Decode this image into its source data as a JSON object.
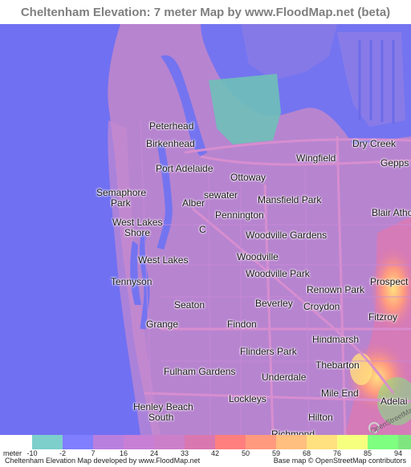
{
  "title": "Cheltenham Elevation: 7 meter Map by www.FloodMap.net (beta)",
  "places": [
    {
      "name": "Peterhead",
      "id": "peterhead"
    },
    {
      "name": "Birkenhead",
      "id": "birkenhead"
    },
    {
      "name": "Dry Creek",
      "id": "dry-creek"
    },
    {
      "name": "Wingfield",
      "id": "wingfield"
    },
    {
      "name": "Gepps C",
      "id": "gepps-c"
    },
    {
      "name": "Port Adelaide",
      "id": "port-adelaide"
    },
    {
      "name": "Ottoway",
      "id": "ottoway"
    },
    {
      "name": "Semaphore",
      "id": "semaphore"
    },
    {
      "name": "Park",
      "id": "semaphore-park"
    },
    {
      "name": "sewater",
      "id": "sewater"
    },
    {
      "name": "Mansfield Park",
      "id": "mansfield-park"
    },
    {
      "name": "Alber",
      "id": "alber"
    },
    {
      "name": "Blair Atho",
      "id": "blair-atho"
    },
    {
      "name": "Pennington",
      "id": "pennington"
    },
    {
      "name": "West Lakes",
      "id": "west-lakes-1"
    },
    {
      "name": "Shore",
      "id": "west-lakes-shore"
    },
    {
      "name": "C",
      "id": "c-label"
    },
    {
      "name": "Woodville Gardens",
      "id": "woodville-gardens"
    },
    {
      "name": "West Lakes",
      "id": "west-lakes-2"
    },
    {
      "name": "Woodville",
      "id": "woodville"
    },
    {
      "name": "Woodville Park",
      "id": "woodville-park"
    },
    {
      "name": "Prospect",
      "id": "prospect"
    },
    {
      "name": "Tennyson",
      "id": "tennyson"
    },
    {
      "name": "Renown Park",
      "id": "renown-park"
    },
    {
      "name": "Seaton",
      "id": "seaton"
    },
    {
      "name": "Beverley",
      "id": "beverley"
    },
    {
      "name": "Croydon",
      "id": "croydon"
    },
    {
      "name": "Fitzroy",
      "id": "fitzroy"
    },
    {
      "name": "Grange",
      "id": "grange"
    },
    {
      "name": "Findon",
      "id": "findon"
    },
    {
      "name": "Hindmarsh",
      "id": "hindmarsh"
    },
    {
      "name": "Flinders Park",
      "id": "flinders-park"
    },
    {
      "name": "Thebarton",
      "id": "thebarton"
    },
    {
      "name": "Fulham Gardens",
      "id": "fulham-gardens"
    },
    {
      "name": "Underdale",
      "id": "underdale"
    },
    {
      "name": "Mile End",
      "id": "mile-end"
    },
    {
      "name": "Adelai",
      "id": "adelai"
    },
    {
      "name": "Lockleys",
      "id": "lockleys"
    },
    {
      "name": "Henley Beach",
      "id": "henley-beach"
    },
    {
      "name": "South",
      "id": "henley-beach-south"
    },
    {
      "name": "Hilton",
      "id": "hilton"
    },
    {
      "name": "Richmond",
      "id": "richmond"
    }
  ],
  "osm_badge": "OpenStreetMap",
  "legend": {
    "unit_label": "meter",
    "ticks": [
      "-10",
      "-2",
      "7",
      "16",
      "24",
      "33",
      "42",
      "50",
      "59",
      "68",
      "76",
      "85",
      "94"
    ],
    "colors": [
      "#7ccfcb",
      "#7f7fff",
      "#b97fde",
      "#c77fd6",
      "#cc7fc9",
      "#d977b0",
      "#ff7f7f",
      "#ff9a7f",
      "#ffbf7f",
      "#ffe07f",
      "#f7ff7f",
      "#7fff7f",
      "#7fe67f"
    ]
  },
  "footer": {
    "left": "Cheltenham Elevation Map developed by www.FloodMap.net",
    "right": "Base map © OpenStreetMap contributors"
  }
}
